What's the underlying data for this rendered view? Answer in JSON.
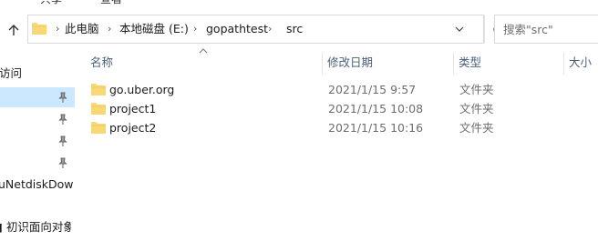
{
  "ribbon": {
    "tab1": "共享",
    "tab2": "查看"
  },
  "address_bar": {
    "crumbs": [
      "此电脑",
      "本地磁盘 (E:)",
      "gopathtest",
      "src"
    ]
  },
  "search": {
    "placeholder": "搜索\"src\""
  },
  "nav_pane": {
    "items": [
      {
        "label": "访问"
      },
      {
        "label": ""
      },
      {
        "label": ""
      },
      {
        "label": ""
      },
      {
        "label": ""
      },
      {
        "label": "uNetdiskDow"
      },
      {
        "label": "▮ 初识面向对象"
      }
    ]
  },
  "columns": {
    "name": "名称",
    "date": "修改日期",
    "type": "类型",
    "size": "大小"
  },
  "files": [
    {
      "name": "go.uber.org",
      "date": "2021/1/15 9:57",
      "type": "文件夹"
    },
    {
      "name": "project1",
      "date": "2021/1/15 10:08",
      "type": "文件夹"
    },
    {
      "name": "project2",
      "date": "2021/1/15 10:16",
      "type": "文件夹"
    }
  ],
  "colors": {
    "folder": "#f8d775",
    "selection": "#cce8ff",
    "header_text": "#4c607a"
  }
}
